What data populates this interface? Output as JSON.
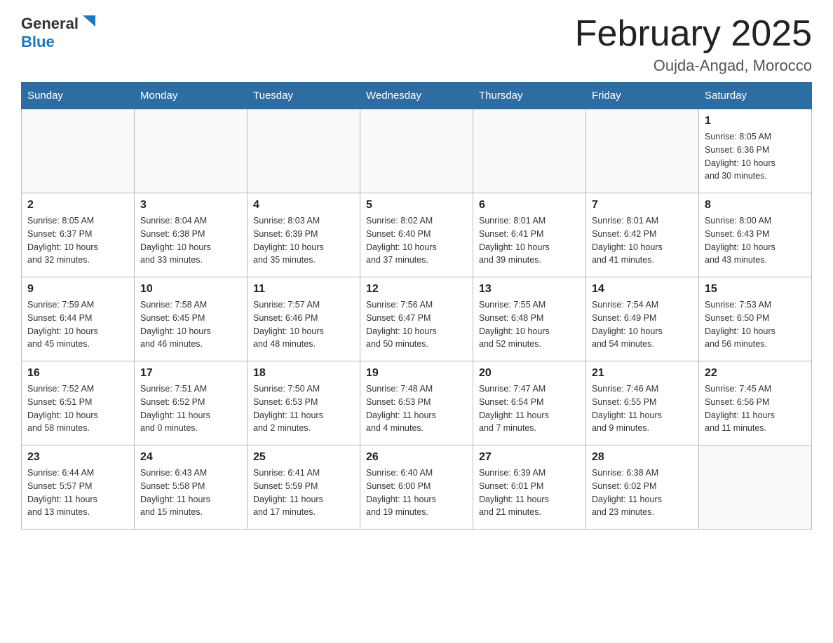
{
  "header": {
    "logo_general": "General",
    "logo_blue": "Blue",
    "month_title": "February 2025",
    "location": "Oujda-Angad, Morocco"
  },
  "days_of_week": [
    "Sunday",
    "Monday",
    "Tuesday",
    "Wednesday",
    "Thursday",
    "Friday",
    "Saturday"
  ],
  "weeks": [
    [
      {
        "day": "",
        "info": ""
      },
      {
        "day": "",
        "info": ""
      },
      {
        "day": "",
        "info": ""
      },
      {
        "day": "",
        "info": ""
      },
      {
        "day": "",
        "info": ""
      },
      {
        "day": "",
        "info": ""
      },
      {
        "day": "1",
        "info": "Sunrise: 8:05 AM\nSunset: 6:36 PM\nDaylight: 10 hours\nand 30 minutes."
      }
    ],
    [
      {
        "day": "2",
        "info": "Sunrise: 8:05 AM\nSunset: 6:37 PM\nDaylight: 10 hours\nand 32 minutes."
      },
      {
        "day": "3",
        "info": "Sunrise: 8:04 AM\nSunset: 6:38 PM\nDaylight: 10 hours\nand 33 minutes."
      },
      {
        "day": "4",
        "info": "Sunrise: 8:03 AM\nSunset: 6:39 PM\nDaylight: 10 hours\nand 35 minutes."
      },
      {
        "day": "5",
        "info": "Sunrise: 8:02 AM\nSunset: 6:40 PM\nDaylight: 10 hours\nand 37 minutes."
      },
      {
        "day": "6",
        "info": "Sunrise: 8:01 AM\nSunset: 6:41 PM\nDaylight: 10 hours\nand 39 minutes."
      },
      {
        "day": "7",
        "info": "Sunrise: 8:01 AM\nSunset: 6:42 PM\nDaylight: 10 hours\nand 41 minutes."
      },
      {
        "day": "8",
        "info": "Sunrise: 8:00 AM\nSunset: 6:43 PM\nDaylight: 10 hours\nand 43 minutes."
      }
    ],
    [
      {
        "day": "9",
        "info": "Sunrise: 7:59 AM\nSunset: 6:44 PM\nDaylight: 10 hours\nand 45 minutes."
      },
      {
        "day": "10",
        "info": "Sunrise: 7:58 AM\nSunset: 6:45 PM\nDaylight: 10 hours\nand 46 minutes."
      },
      {
        "day": "11",
        "info": "Sunrise: 7:57 AM\nSunset: 6:46 PM\nDaylight: 10 hours\nand 48 minutes."
      },
      {
        "day": "12",
        "info": "Sunrise: 7:56 AM\nSunset: 6:47 PM\nDaylight: 10 hours\nand 50 minutes."
      },
      {
        "day": "13",
        "info": "Sunrise: 7:55 AM\nSunset: 6:48 PM\nDaylight: 10 hours\nand 52 minutes."
      },
      {
        "day": "14",
        "info": "Sunrise: 7:54 AM\nSunset: 6:49 PM\nDaylight: 10 hours\nand 54 minutes."
      },
      {
        "day": "15",
        "info": "Sunrise: 7:53 AM\nSunset: 6:50 PM\nDaylight: 10 hours\nand 56 minutes."
      }
    ],
    [
      {
        "day": "16",
        "info": "Sunrise: 7:52 AM\nSunset: 6:51 PM\nDaylight: 10 hours\nand 58 minutes."
      },
      {
        "day": "17",
        "info": "Sunrise: 7:51 AM\nSunset: 6:52 PM\nDaylight: 11 hours\nand 0 minutes."
      },
      {
        "day": "18",
        "info": "Sunrise: 7:50 AM\nSunset: 6:53 PM\nDaylight: 11 hours\nand 2 minutes."
      },
      {
        "day": "19",
        "info": "Sunrise: 7:48 AM\nSunset: 6:53 PM\nDaylight: 11 hours\nand 4 minutes."
      },
      {
        "day": "20",
        "info": "Sunrise: 7:47 AM\nSunset: 6:54 PM\nDaylight: 11 hours\nand 7 minutes."
      },
      {
        "day": "21",
        "info": "Sunrise: 7:46 AM\nSunset: 6:55 PM\nDaylight: 11 hours\nand 9 minutes."
      },
      {
        "day": "22",
        "info": "Sunrise: 7:45 AM\nSunset: 6:56 PM\nDaylight: 11 hours\nand 11 minutes."
      }
    ],
    [
      {
        "day": "23",
        "info": "Sunrise: 6:44 AM\nSunset: 5:57 PM\nDaylight: 11 hours\nand 13 minutes."
      },
      {
        "day": "24",
        "info": "Sunrise: 6:43 AM\nSunset: 5:58 PM\nDaylight: 11 hours\nand 15 minutes."
      },
      {
        "day": "25",
        "info": "Sunrise: 6:41 AM\nSunset: 5:59 PM\nDaylight: 11 hours\nand 17 minutes."
      },
      {
        "day": "26",
        "info": "Sunrise: 6:40 AM\nSunset: 6:00 PM\nDaylight: 11 hours\nand 19 minutes."
      },
      {
        "day": "27",
        "info": "Sunrise: 6:39 AM\nSunset: 6:01 PM\nDaylight: 11 hours\nand 21 minutes."
      },
      {
        "day": "28",
        "info": "Sunrise: 6:38 AM\nSunset: 6:02 PM\nDaylight: 11 hours\nand 23 minutes."
      },
      {
        "day": "",
        "info": ""
      }
    ]
  ]
}
